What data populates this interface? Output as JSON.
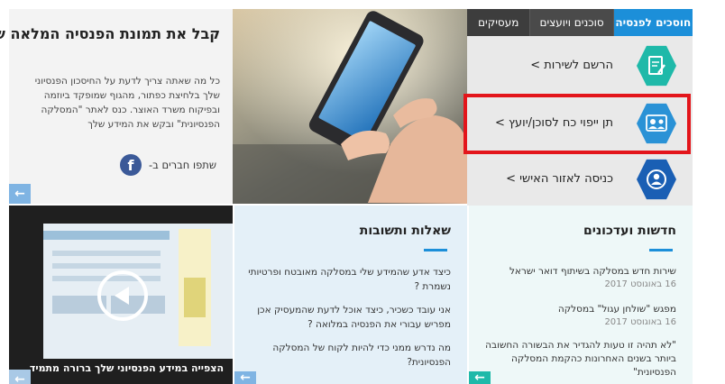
{
  "tabs": [
    {
      "label": "חוסכים לפנסיה",
      "active": true
    },
    {
      "label": "סוכנים ויועצים",
      "active": false
    },
    {
      "label": "מעסיקים",
      "active": false
    }
  ],
  "actions": [
    {
      "label": "הרשם לשירות >",
      "icon": "document-edit-icon"
    },
    {
      "label": "תן ייפוי כח לסוכן/יועץ >",
      "icon": "agents-icon",
      "highlighted": true
    },
    {
      "label": "כניסה לאזור האישי >",
      "icon": "user-circle-icon"
    }
  ],
  "article": {
    "title": "קבל את תמונת הפנסיה המלאה שלך",
    "body": "כל מה שאתה צריך לדעת על החיסכון הפנסיוני שלך בלחיצת כפתור, מהגוף שמופקד ביוזמה ובפיקוח משרד האוצר. כנס לאתר \"המסלקה הפנסיונית\" ובקש את המידע שלך",
    "share_label": "שתפו חברים ב-",
    "facebook_glyph": "f"
  },
  "video": {
    "caption": "הצפייה במידע הפנסיוני שלך ברורה מתמיד"
  },
  "qa": {
    "title": "שאלות ותשובות",
    "items": [
      "כיצד אדע שהמידע שלי במסלקה מאובטח ופרטיותי נשמרת ?",
      "אני עובד כשכיר, כיצד אוכל לדעת שהמעסיק אכן מפריש עבורי את הפנסיה במלואה ?",
      "מה נדרש ממני כדי להיות לקוח של המסלקה הפנסיונית?"
    ]
  },
  "news": {
    "title": "חדשות ועדכונים",
    "items": [
      {
        "title": "שירות חדש במסלקה בשיתוף דואר ישראל",
        "date": "16 באוגוסט 2017"
      },
      {
        "title": "מפגש \"שולחן עגול\" במסלקה",
        "date": "16 באוגוסט 2017"
      },
      {
        "title": "\"לא תהיה זו טעות להגדיר את הבשורה החשובה ביותר בשנים האחרונות כהקמת המסלקה הפנסיונית\"",
        "date": ""
      }
    ]
  },
  "colors": {
    "accent": "#1c8fd9",
    "highlight": "#e3151b",
    "tab_bar": "#3d3d3d"
  }
}
